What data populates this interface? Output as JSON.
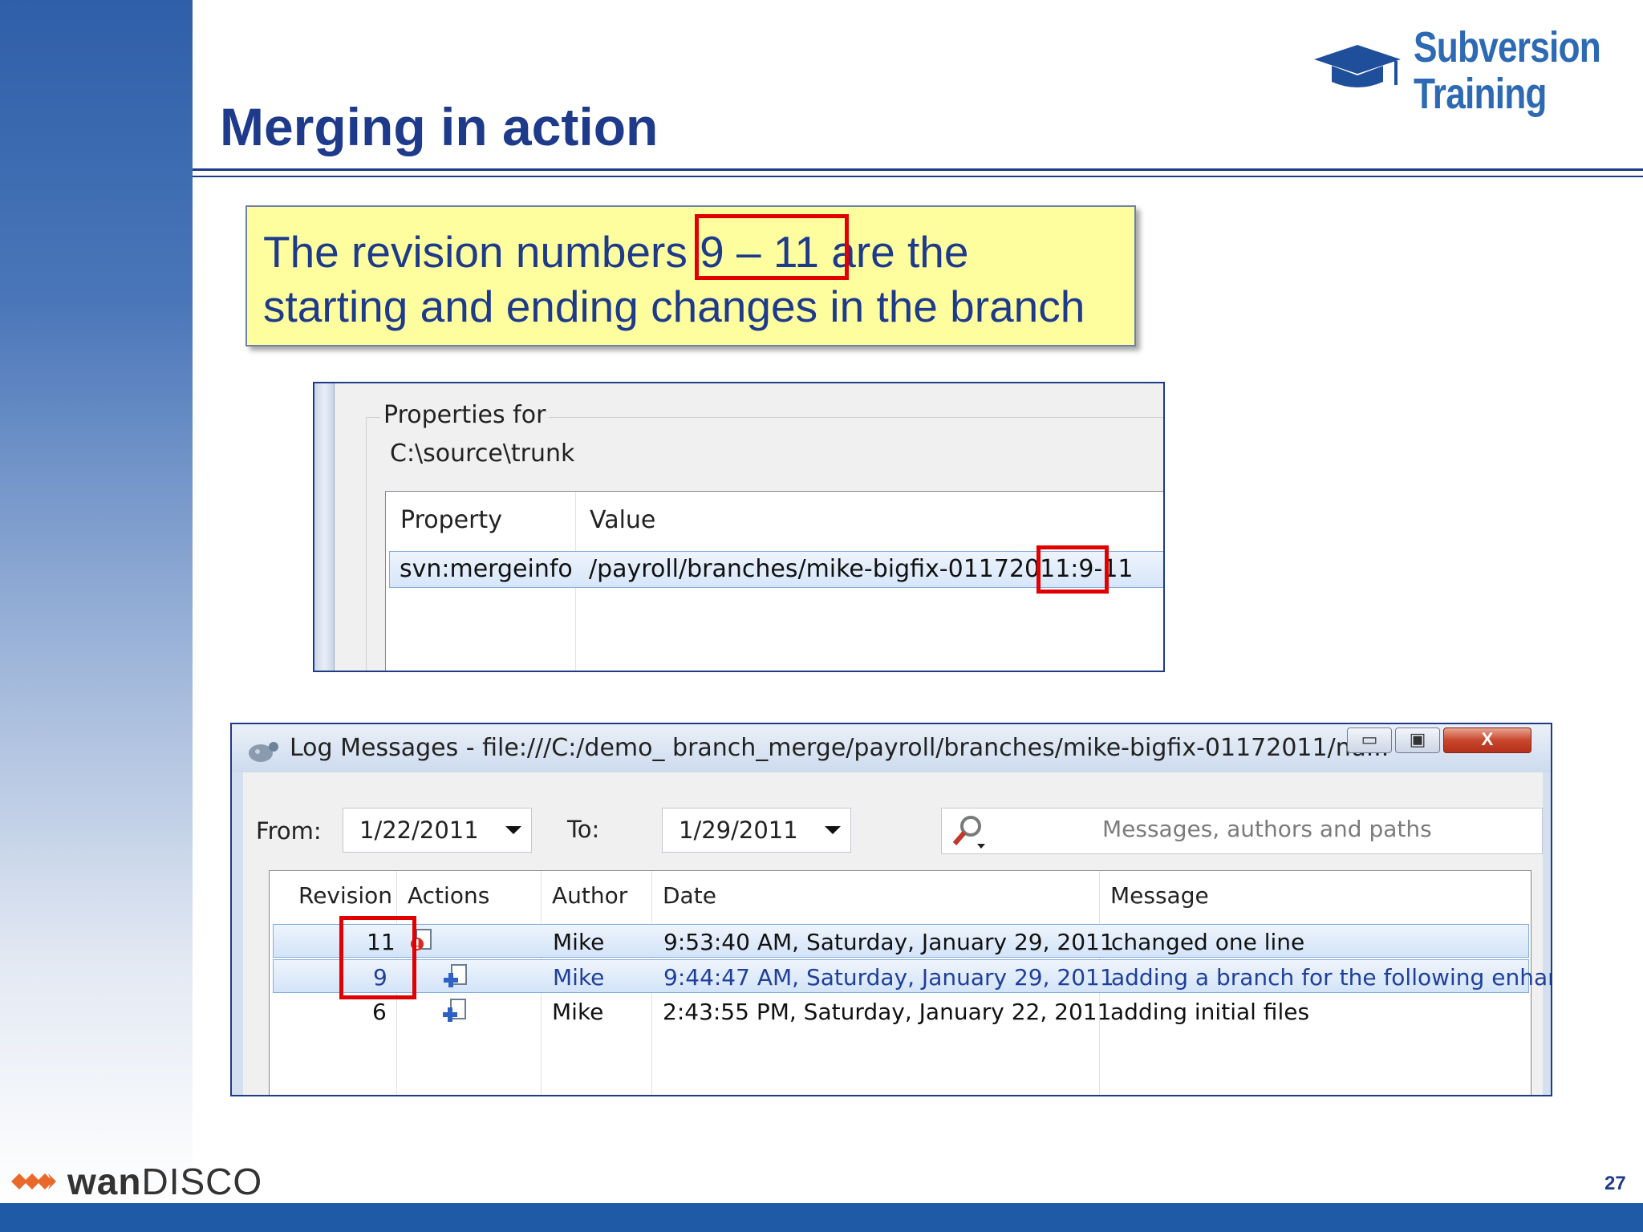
{
  "slide": {
    "title": "Merging in action",
    "page_number": "27",
    "brand": {
      "line1": "Subversion",
      "line2": "Training",
      "color": "#2e6ab3"
    },
    "footer_brand": {
      "bold": "wan",
      "regular": "DISCO"
    },
    "callout": {
      "line1_before": "The revision numbers",
      "line1_highlight": " 9 – 11 ",
      "line1_after": "are the",
      "line2": "starting and ending changes in the branch"
    }
  },
  "properties_window": {
    "group_label": "Properties for",
    "path": "C:\\source\\trunk",
    "columns": {
      "property": "Property",
      "value": "Value"
    },
    "row": {
      "property": "svn:mergeinfo",
      "value_prefix": "/payroll/branches/mike-bigfix-01172011:",
      "value_range": "9-11"
    }
  },
  "log_window": {
    "title": "Log Messages - file:///C:/demo_ branch_merge/payroll/branches/mike-bigfix-01172011/nu...",
    "controls": {
      "minimize": "▭",
      "maximize": "▣",
      "close": "X"
    },
    "from_label": "From:",
    "from_value": "1/22/2011",
    "to_label": "To:",
    "to_value": "1/29/2011",
    "search_placeholder": "Messages, authors and paths",
    "columns": {
      "revision": "Revision",
      "actions": "Actions",
      "author": "Author",
      "date": "Date",
      "message": "Message"
    },
    "rows": [
      {
        "revision": "11",
        "author": "Mike",
        "date": "9:53:40 AM, Saturday, January 29, 2011",
        "message": "changed one line",
        "action_icon": "modified-file-icon"
      },
      {
        "revision": "9",
        "author": "Mike",
        "date": "9:44:47 AM, Saturday, January 29, 2011",
        "message": "adding a branch for the following enhanc",
        "action_icon": "added-file-icon"
      },
      {
        "revision": "6",
        "author": "Mike",
        "date": "2:43:55 PM, Saturday, January 22, 2011",
        "message": "adding initial files",
        "action_icon": "added-file-icon"
      }
    ]
  },
  "colors": {
    "title": "#1e3a8a",
    "highlight_box": "#e00000",
    "callout_bg": "#fefe9e",
    "selection": "#d3e4f8"
  }
}
